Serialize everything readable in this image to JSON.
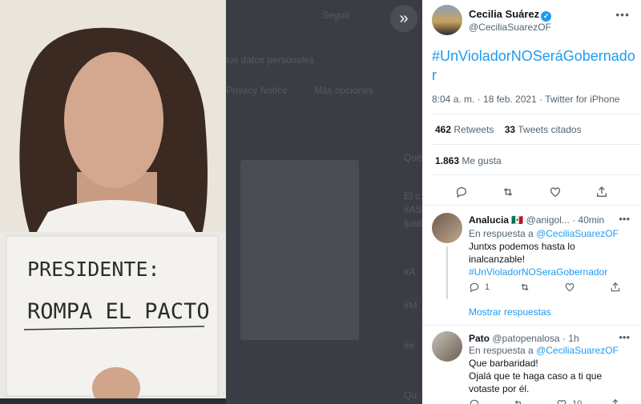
{
  "photo": {
    "sign_line1": "PRESIDENTE:",
    "sign_line2": "ROMPA EL PACTO"
  },
  "backdrop": {
    "ghost_texts": [
      "Seguir",
      "los datos personales",
      "Privacy Notice",
      "Más opciones",
      "Qué",
      "El c",
      "#AS",
      "Ipad",
      "#A",
      "#M",
      "#e",
      "Qu"
    ]
  },
  "tweet": {
    "author_name": "Cecilia Suárez",
    "author_handle": "@CeciliaSuarezOF",
    "hashtag": "#UnVioladorNOSeráGobernador",
    "meta": "8:04 a. m. · 18 feb. 2021 · Twitter for iPhone",
    "retweets_count": "462",
    "retweets_label": "Retweets",
    "quotes_count": "33",
    "quotes_label": "Tweets citados",
    "likes_count": "1.863",
    "likes_label": "Me gusta"
  },
  "replies": [
    {
      "name": "Analucia 🇲🇽",
      "handle_time": "@anigol... · 40min",
      "reply_to_prefix": "En respuesta a",
      "reply_to_handle": "@CeciliaSuarezOF",
      "line1": "Juntxs podemos hasta lo",
      "line2": "inalcanzable!",
      "hashtag": "#UnVioladorNOSeraGobernador",
      "reply_count": "1",
      "retweet_count": "",
      "like_count": "",
      "show_replies": "Mostrar respuestas"
    },
    {
      "name": "Pato",
      "handle_time": "@patopenalosa · 1h",
      "reply_to_prefix": "En respuesta a",
      "reply_to_handle": "@CeciliaSuarezOF",
      "line1": "Que barbaridad!",
      "line2": "Ojalá que te haga caso a ti que",
      "line3": "votaste por él.",
      "reply_count": "",
      "retweet_count": "",
      "like_count": "10"
    }
  ],
  "colors": {
    "accent": "#1d9bf0",
    "text_secondary": "#536471",
    "backdrop": "#3a3d44"
  }
}
